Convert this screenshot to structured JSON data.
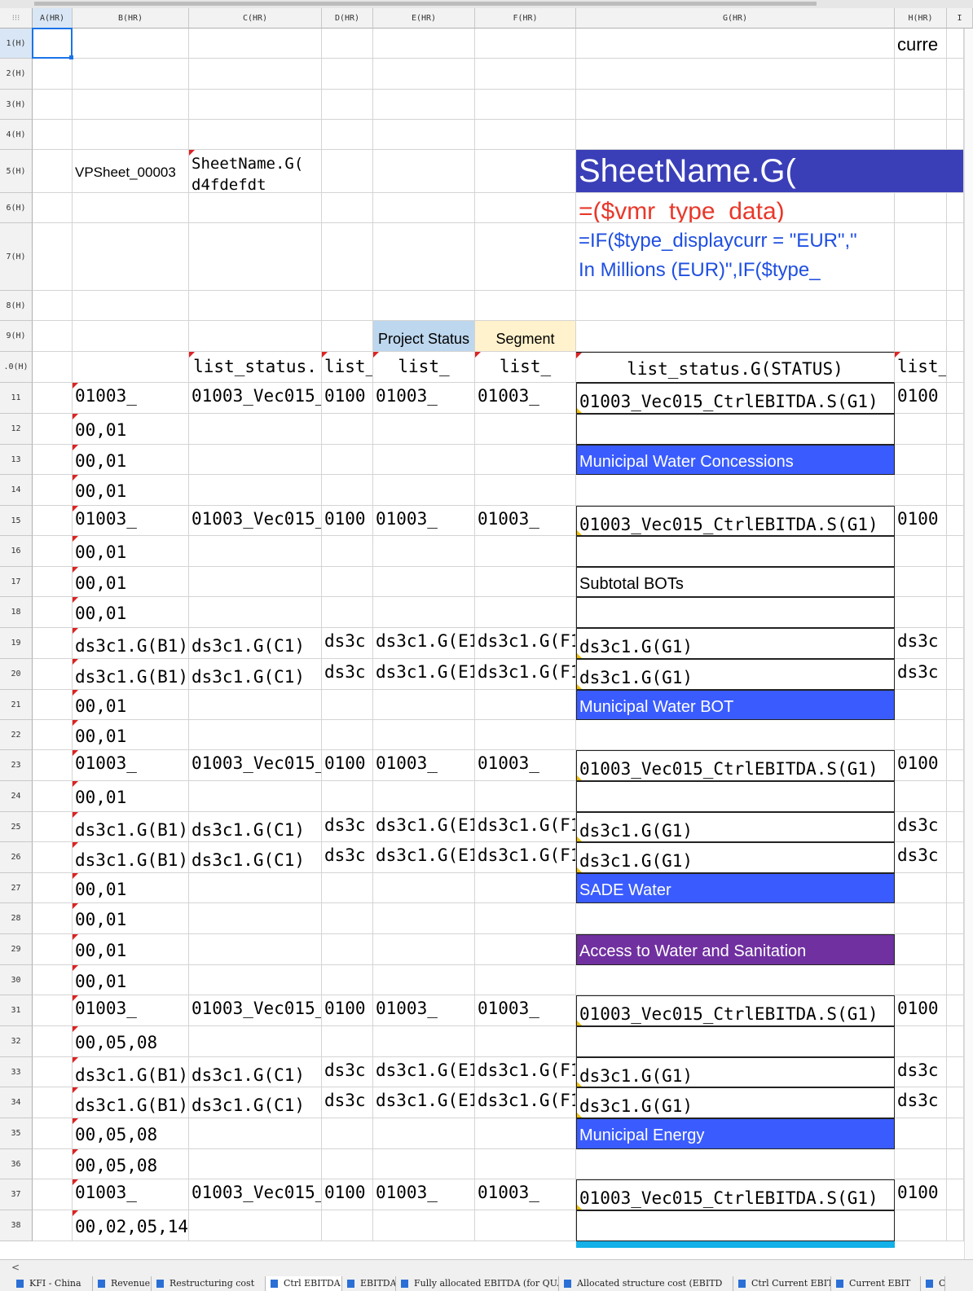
{
  "column_headers": [
    "A(HR)",
    "B(HR)",
    "C(HR)",
    "D(HR)",
    "E(HR)",
    "F(HR)",
    "G(HR)",
    "H(HR)",
    "I"
  ],
  "row_labels": [
    "1(H)",
    "2(H)",
    "3(H)",
    "4(H)",
    "5(H)",
    "6(H)",
    "7(H)",
    "8(H)",
    "9(H)",
    ".0(H)",
    "11",
    "12",
    "13",
    "14",
    "15",
    "16",
    "17",
    "18",
    "19",
    "20",
    "21",
    "22",
    "23",
    "24",
    "25",
    "26",
    "27",
    "28",
    "29",
    "30",
    "31",
    "32",
    "33",
    "34",
    "35",
    "36",
    "37",
    "38"
  ],
  "cells": {
    "H1": "curre",
    "B5": "VPSheet_00003",
    "C5": "SheetName.G(",
    "C5b": "d4fdefdt",
    "G5": "SheetName.G(",
    "G6": "=($vmr_type_data)",
    "G7a": "=IF($type_displaycurr = \"EUR\",\"",
    "G7b": "In Millions (EUR)\",IF($type_",
    "E9": "Project Status",
    "F9": "Segment",
    "C10": "list_status.",
    "D10": "list_",
    "E10": "list_",
    "F10": "list_",
    "G10": "list_status.G(STATUS)",
    "H10": "list_",
    "code_b": "01003_",
    "code_c": "01003_Vec015_",
    "code_d": "0100",
    "code_e": "01003_",
    "code_f": "01003_",
    "code_g": "01003_Vec015_CtrlEBITDA.S(G1)",
    "code_h": "0100",
    "ds_b": "ds3c1.G(B1)",
    "ds_c": "ds3c1.G(C1)",
    "ds_d": "ds3c",
    "ds_e": "ds3c1.G(E1",
    "ds_f": "ds3c1.G(F1",
    "ds_g": "ds3c1.G(G1)",
    "ds_h": "ds3c",
    "b_0001": "00,01",
    "b_000508": "00,05,08",
    "b_00020514": "00,02,05,14",
    "G13": "Municipal Water Concessions",
    "G17": "Subtotal BOTs",
    "G21": "Municipal Water BOT",
    "G27": "SADE Water",
    "G29": "Access to Water and Sanitation",
    "G35": "Municipal Energy"
  },
  "tabs": [
    {
      "label": "KFI - China"
    },
    {
      "label": "Revenue"
    },
    {
      "label": "Restructuring cost"
    },
    {
      "label": "Ctrl EBITDA"
    },
    {
      "label": "EBITDA"
    },
    {
      "label": "Fully allocated EBITDA (for QUA"
    },
    {
      "label": "Allocated structure cost (EBITD"
    },
    {
      "label": "Ctrl Current EBIT"
    },
    {
      "label": "Current EBIT"
    },
    {
      "label": "C"
    }
  ],
  "active_tab": "Ctrl EBITDA",
  "colors": {
    "blue_band": "#3a5cff",
    "purple_band": "#7030a0",
    "navy_header": "#3a3fb8",
    "project_status_fill": "#bdd7ee",
    "segment_fill": "#fff2cc",
    "formula_red": "#e8382a",
    "formula_blue": "#1f4fe0",
    "cyan_band": "#14b0e8"
  }
}
